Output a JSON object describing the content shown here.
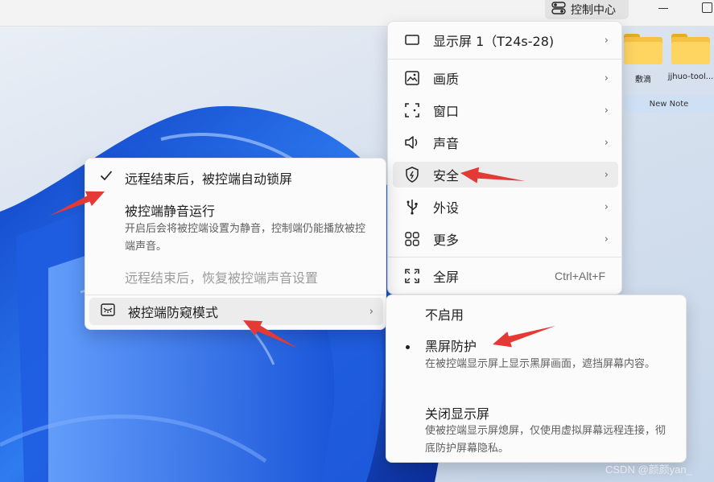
{
  "topbar": {
    "control_center_label": "控制中心"
  },
  "desktop": {
    "icons": [
      {
        "label": "敷滴"
      },
      {
        "label": "jjhuo-tool..."
      }
    ],
    "note_label": "New Note"
  },
  "main_menu": {
    "items": [
      {
        "label": "显示屏 1（T24s-28)",
        "icon": "monitor-icon",
        "has_submenu": true
      },
      {
        "label": "画质",
        "icon": "image-quality-icon",
        "has_submenu": true
      },
      {
        "label": "窗口",
        "icon": "window-frame-icon",
        "has_submenu": true
      },
      {
        "label": "声音",
        "icon": "speaker-icon",
        "has_submenu": true
      },
      {
        "label": "安全",
        "icon": "shield-icon",
        "has_submenu": true,
        "highlighted": true
      },
      {
        "label": "外设",
        "icon": "usb-icon",
        "has_submenu": true
      },
      {
        "label": "更多",
        "icon": "grid-icon",
        "has_submenu": true
      },
      {
        "label": "全屏",
        "icon": "fullscreen-icon",
        "shortcut": "Ctrl+Alt+F"
      }
    ]
  },
  "security_menu": {
    "auto_lock": {
      "label": "远程结束后，被控端自动锁屏",
      "checked": true
    },
    "silent_run": {
      "label": "被控端静音运行",
      "desc": "开启后会将被控端设置为静音，控制端仍能播放被控端声音。"
    },
    "restore_sound": {
      "label": "远程结束后，恢复被控端声音设置",
      "disabled": true
    },
    "privacy_mode": {
      "label": "被控端防窥模式",
      "icon": "eye-closed-icon"
    }
  },
  "privacy_submenu": {
    "options": [
      {
        "label": "不启用",
        "desc": ""
      },
      {
        "label": "黑屏防护",
        "desc": "在被控端显示屏上显示黑屏画面，遮挡屏幕内容。",
        "selected": true
      },
      {
        "label": "关闭显示屏",
        "desc": "使被控端显示屏熄屏，仅使用虚拟屏幕远程连接，彻底防护屏幕隐私。"
      }
    ]
  },
  "annotations": {
    "arrow_color": "#e53935"
  },
  "watermark": "CSDN @颜颜yan_"
}
